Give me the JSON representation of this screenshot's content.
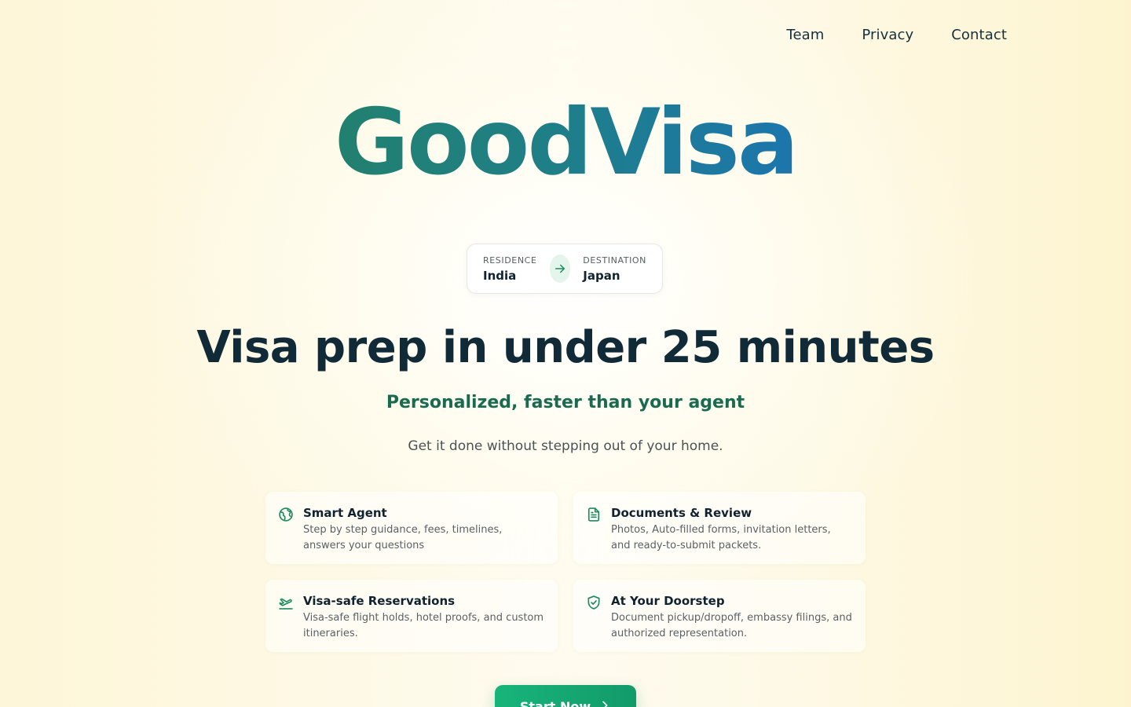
{
  "nav": {
    "items": [
      {
        "label": "Team"
      },
      {
        "label": "Privacy"
      },
      {
        "label": "Contact"
      }
    ]
  },
  "brand": {
    "name": "GoodVisa"
  },
  "route": {
    "residence_label": "RESIDENCE",
    "residence_value": "India",
    "destination_label": "DESTINATION",
    "destination_value": "Japan",
    "arrow_icon": "arrow-right-icon"
  },
  "hero": {
    "headline": "Visa prep in under 25 minutes",
    "subheadline": "Personalized, faster than your agent",
    "description": "Get it done without stepping out of your home."
  },
  "features": [
    {
      "icon": "globe-icon",
      "title": "Smart Agent",
      "text": "Step by step guidance, fees, timelines, answers your questions"
    },
    {
      "icon": "document-icon",
      "title": "Documents & Review",
      "text": "Photos, Auto-filled forms, invitation letters, and ready-to-submit packets."
    },
    {
      "icon": "plane-departure-icon",
      "title": "Visa-safe Reservations",
      "text": "Visa-safe flight holds, hotel proofs, and custom itineraries."
    },
    {
      "icon": "shield-check-icon",
      "title": "At Your Doorstep",
      "text": "Document pickup/dropoff, embassy filings, and authorized representation."
    }
  ],
  "cta": {
    "label": "Start Now",
    "icon": "chevron-right-icon"
  },
  "colors": {
    "accent_green": "#1a6a50",
    "brand_teal": "#22806f",
    "brand_blue": "#1c76ad",
    "cta_green": "#17b57a",
    "icon_green": "#1f8a5f"
  }
}
